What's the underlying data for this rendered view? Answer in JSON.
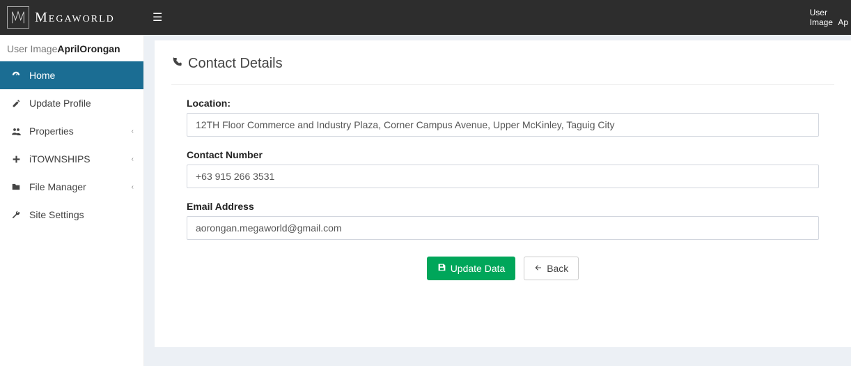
{
  "brand": {
    "name": "Megaworld"
  },
  "topbar": {
    "user_image_label": "User\nImage",
    "user_short": "Ap"
  },
  "user_panel": {
    "image_text": "User Image",
    "name": "AprilOrongan"
  },
  "sidebar": {
    "items": [
      {
        "label": "Home",
        "icon": "dashboard-icon",
        "active": true,
        "expandable": false
      },
      {
        "label": "Update Profile",
        "icon": "pencil-icon",
        "active": false,
        "expandable": false
      },
      {
        "label": "Properties",
        "icon": "people-icon",
        "active": false,
        "expandable": true
      },
      {
        "label": "iTOWNSHIPS",
        "icon": "plus-icon",
        "active": false,
        "expandable": true
      },
      {
        "label": "File Manager",
        "icon": "folder-icon",
        "active": false,
        "expandable": true
      },
      {
        "label": "Site Settings",
        "icon": "wrench-icon",
        "active": false,
        "expandable": false
      }
    ]
  },
  "panel": {
    "title": "Contact Details",
    "location_label": "Location:",
    "location_value": "12TH Floor Commerce and Industry Plaza, Corner Campus Avenue, Upper McKinley, Taguig City",
    "phone_label": "Contact Number",
    "phone_value": "+63 915 266 3531",
    "email_label": "Email Address",
    "email_value": "aorongan.megaworld@gmail.com",
    "update_button": "Update Data",
    "back_button": "Back"
  }
}
